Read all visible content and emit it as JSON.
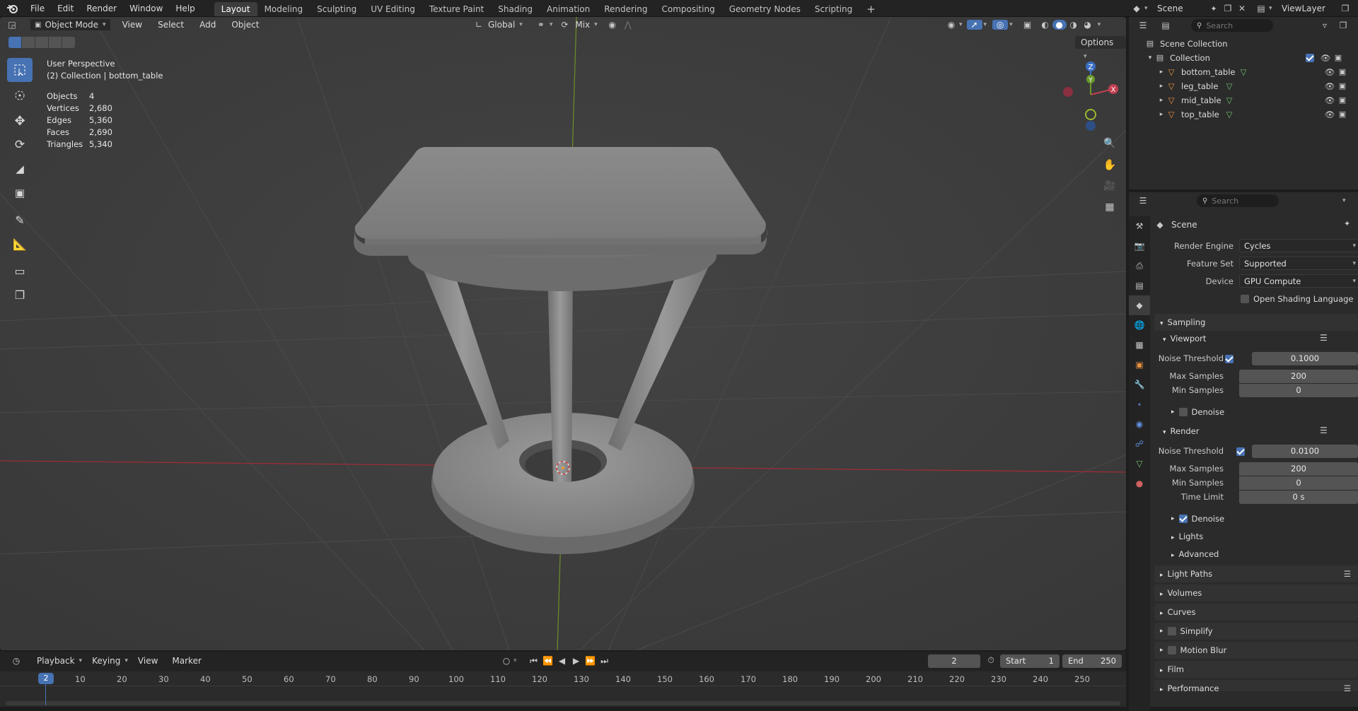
{
  "topbar": {
    "menus": [
      "File",
      "Edit",
      "Render",
      "Window",
      "Help"
    ],
    "workspaces": [
      "Layout",
      "Modeling",
      "Sculpting",
      "UV Editing",
      "Texture Paint",
      "Shading",
      "Animation",
      "Rendering",
      "Compositing",
      "Geometry Nodes",
      "Scripting"
    ],
    "active_workspace": "Layout",
    "scene_name": "Scene",
    "view_layer": "ViewLayer"
  },
  "viewport": {
    "mode": "Object Mode",
    "menus": [
      "View",
      "Select",
      "Add",
      "Object"
    ],
    "transform_orientation": "Global",
    "snap_mode": "Mix",
    "options_label": "Options",
    "perspective": "User Perspective",
    "collection_info": "(2) Collection | bottom_table",
    "stats": [
      {
        "label": "Objects",
        "value": "4"
      },
      {
        "label": "Vertices",
        "value": "2,680"
      },
      {
        "label": "Edges",
        "value": "5,360"
      },
      {
        "label": "Faces",
        "value": "2,690"
      },
      {
        "label": "Triangles",
        "value": "5,340"
      }
    ],
    "gizmo": {
      "x": "X",
      "y": "Y",
      "z": "Z"
    },
    "colors": {
      "bg": "#3d3d3d",
      "grid": "#484848",
      "x_axis": "#9b2d36",
      "y_axis": "#6a8a2a",
      "accent": "#4772b3"
    }
  },
  "outliner": {
    "search_placeholder": "Search",
    "scene_collection": "Scene Collection",
    "collection": "Collection",
    "objects": [
      "bottom_table",
      "leg_table",
      "mid_table",
      "top_table"
    ]
  },
  "properties": {
    "search_placeholder": "Search",
    "context": "Scene",
    "render_engine_label": "Render Engine",
    "render_engine": "Cycles",
    "feature_set_label": "Feature Set",
    "feature_set": "Supported",
    "device_label": "Device",
    "device": "GPU Compute",
    "osl_label": "Open Shading Language",
    "sampling": "Sampling",
    "viewport_label": "Viewport",
    "render_label": "Render",
    "noise_threshold_label": "Noise Threshold",
    "max_samples_label": "Max Samples",
    "min_samples_label": "Min Samples",
    "time_limit_label": "Time Limit",
    "denoise_label": "Denoise",
    "viewport_noise": "0.1000",
    "viewport_max": "200",
    "viewport_min": "0",
    "render_noise": "0.0100",
    "render_max": "200",
    "render_min": "0",
    "render_time": "0 s",
    "lights": "Lights",
    "advanced": "Advanced",
    "sections": [
      "Light Paths",
      "Volumes",
      "Curves",
      "Simplify",
      "Motion Blur",
      "Film",
      "Performance"
    ]
  },
  "timeline": {
    "menus": [
      "Playback",
      "Keying",
      "View",
      "Marker"
    ],
    "current_frame": "2",
    "start_label": "Start",
    "start": "1",
    "end_label": "End",
    "end": "250",
    "ticks": [
      "10",
      "20",
      "30",
      "40",
      "50",
      "60",
      "70",
      "80",
      "90",
      "100",
      "110",
      "120",
      "130",
      "140",
      "150",
      "160",
      "170",
      "180",
      "190",
      "200",
      "210",
      "220",
      "230",
      "240",
      "250"
    ]
  }
}
